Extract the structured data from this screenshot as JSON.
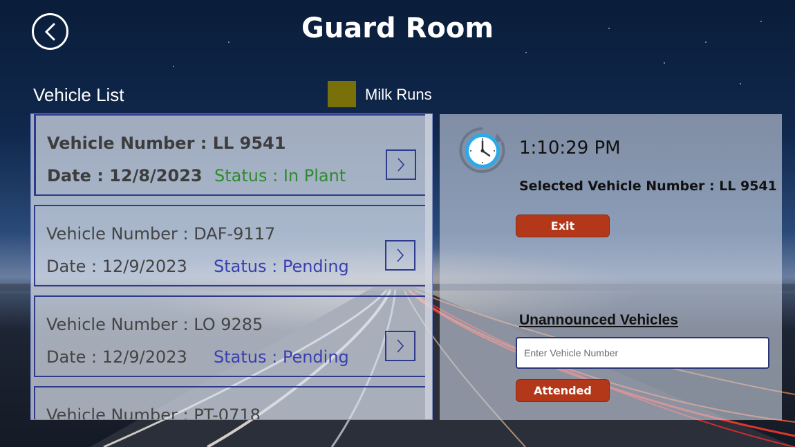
{
  "header": {
    "title": "Guard Room"
  },
  "list": {
    "heading": "Vehicle List",
    "legend_label": "Milk Runs",
    "legend_color": "#7a700a",
    "rows": [
      {
        "number": "Vehicle Number : LL 9541",
        "date": "Date : 12/8/2023",
        "status": "Status : In Plant",
        "status_color": "#2f8a2f",
        "selected": true
      },
      {
        "number": "Vehicle Number : DAF-9117",
        "date": "Date : 12/9/2023",
        "status": "Status : Pending",
        "status_color": "#3a3fb0",
        "selected": false
      },
      {
        "number": "Vehicle Number : LO 9285",
        "date": "Date : 12/9/2023",
        "status": "Status : Pending",
        "status_color": "#3a3fb0",
        "selected": false
      },
      {
        "number": "Vehicle Number : PT-0718",
        "date": "",
        "status": "",
        "status_color": "#3a3fb0",
        "selected": false
      }
    ]
  },
  "detail": {
    "time": "1:10:29 PM",
    "selected_vehicle": "Selected Vehicle Number : LL 9541",
    "exit_label": "Exit",
    "unannounced_label": "Unannounced Vehicles",
    "input_placeholder": "Enter Vehicle Number",
    "attended_label": "Attended"
  },
  "colors": {
    "accent_red": "#b3381a",
    "border_blue": "#2e3a8c"
  }
}
